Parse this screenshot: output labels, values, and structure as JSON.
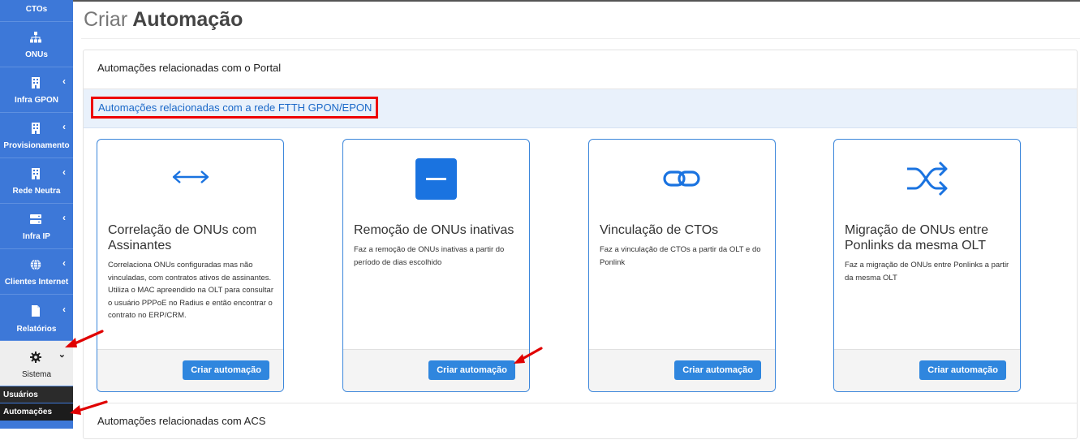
{
  "sidebar": {
    "items": [
      {
        "label": "CTOs",
        "icon": "ctos-icon"
      },
      {
        "label": "ONUs",
        "icon": "sitemap-icon"
      },
      {
        "label": "Infra GPON",
        "icon": "building-icon"
      },
      {
        "label": "Provisionamento",
        "icon": "building-icon"
      },
      {
        "label": "Rede Neutra",
        "icon": "building-icon"
      },
      {
        "label": "Infra IP",
        "icon": "server-icon"
      },
      {
        "label": "Clientes Internet",
        "icon": "globe-icon"
      },
      {
        "label": "Relatórios",
        "icon": "file-icon"
      },
      {
        "label": "Sistema",
        "icon": "gear-icon"
      }
    ],
    "submenu": [
      {
        "label": "Usuários"
      },
      {
        "label": "Automações"
      }
    ]
  },
  "page": {
    "title_light": "Criar",
    "title_bold": "Automação"
  },
  "sections": {
    "portal": "Automações relacionadas com o Portal",
    "ftth": "Automações relacionadas com a rede FTTH GPON/EPON",
    "acs": "Automações relacionadas com ACS"
  },
  "cards": [
    {
      "title": "Correlação de ONUs com Assinantes",
      "description": "Correlaciona ONUs configuradas mas não vinculadas, com contratos ativos de assinantes. Utiliza o MAC apreendido na OLT para consultar o usuário PPPoE no Radius e então encontrar o contrato no ERP/CRM.",
      "button": "Criar automação",
      "icon": "arrows-horizontal-icon"
    },
    {
      "title": "Remoção de ONUs inativas",
      "description": "Faz a remoção de ONUs inativas a partir do período de dias escolhido",
      "button": "Criar automação",
      "icon": "minus-square-icon"
    },
    {
      "title": "Vinculação de CTOs",
      "description": "Faz a vinculação de CTOs a partir da OLT e do Ponlink",
      "button": "Criar automação",
      "icon": "link-icon"
    },
    {
      "title": "Migração de ONUs entre Ponlinks da mesma OLT",
      "description": "Faz a migração de ONUs entre Ponlinks a partir da mesma OLT",
      "button": "Criar automação",
      "icon": "shuffle-icon"
    }
  ],
  "colors": {
    "sidebar": "#3d78d8",
    "accent": "#2f86de",
    "highlight_border": "#ee0000",
    "annotation_arrow": "#e00000"
  }
}
